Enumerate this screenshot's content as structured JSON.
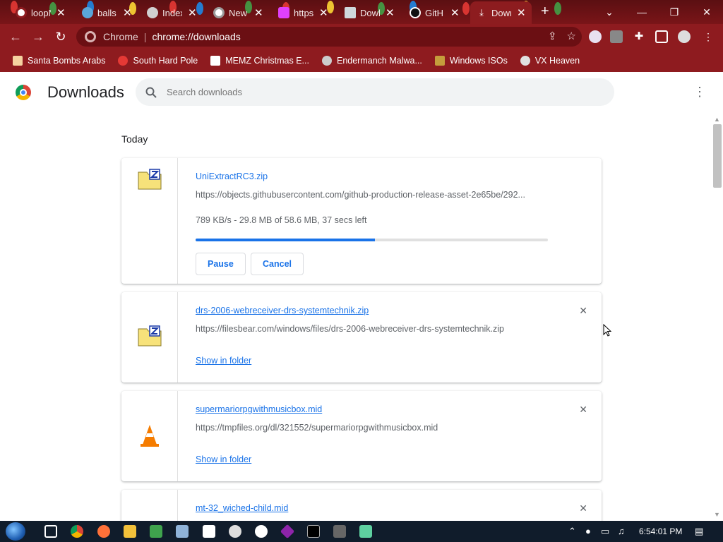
{
  "tabs": [
    {
      "title": "loopN",
      "active": false
    },
    {
      "title": "balls",
      "active": false
    },
    {
      "title": "Index",
      "active": false
    },
    {
      "title": "New",
      "active": false
    },
    {
      "title": "https",
      "active": false
    },
    {
      "title": "Dowl",
      "active": false
    },
    {
      "title": "GitH",
      "active": false
    },
    {
      "title": "Down",
      "active": true
    }
  ],
  "omnibox": {
    "site_label": "Chrome",
    "url": "chrome://downloads"
  },
  "bookmarks": [
    {
      "label": "Santa Bombs Arabs",
      "icon": "santa-icon"
    },
    {
      "label": "South Hard Pole",
      "icon": "snowflake-icon"
    },
    {
      "label": "MEMZ Christmas E...",
      "icon": "memz-icon"
    },
    {
      "label": "Endermanch Malwa...",
      "icon": "endermanch-icon"
    },
    {
      "label": "Windows ISOs",
      "icon": "windows-iso-icon"
    },
    {
      "label": "VX Heaven",
      "icon": "vx-heaven-icon"
    }
  ],
  "page": {
    "title": "Downloads",
    "search_placeholder": "Search downloads",
    "date_header": "Today"
  },
  "downloads": [
    {
      "name": "UniExtractRC3.zip",
      "url": "https://objects.githubusercontent.com/github-production-release-asset-2e65be/292...",
      "status": "789 KB/s - 29.8 MB of 58.6 MB, 37 secs left",
      "progress": 0.51,
      "pause_label": "Pause",
      "cancel_label": "Cancel",
      "icon": "zip-folder-icon"
    },
    {
      "name": "drs-2006-webreceiver-drs-systemtechnik.zip",
      "url": "https://filesbear.com/windows/files/drs-2006-webreceiver-drs-systemtechnik.zip",
      "show_label": "Show in folder",
      "icon": "zip-folder-icon"
    },
    {
      "name": "supermariorpgwithmusicbox.mid",
      "url": "https://tmpfiles.org/dl/321552/supermariorpgwithmusicbox.mid",
      "show_label": "Show in folder",
      "icon": "vlc-cone-icon"
    },
    {
      "name": "mt-32_wiched-child.mid",
      "icon": "vlc-cone-icon"
    }
  ],
  "taskbar": {
    "clock": "6:54:01 PM"
  },
  "colors": {
    "accent": "#1a73e8",
    "frame": "#8e1b1f",
    "taskbar": "#101c2b"
  }
}
